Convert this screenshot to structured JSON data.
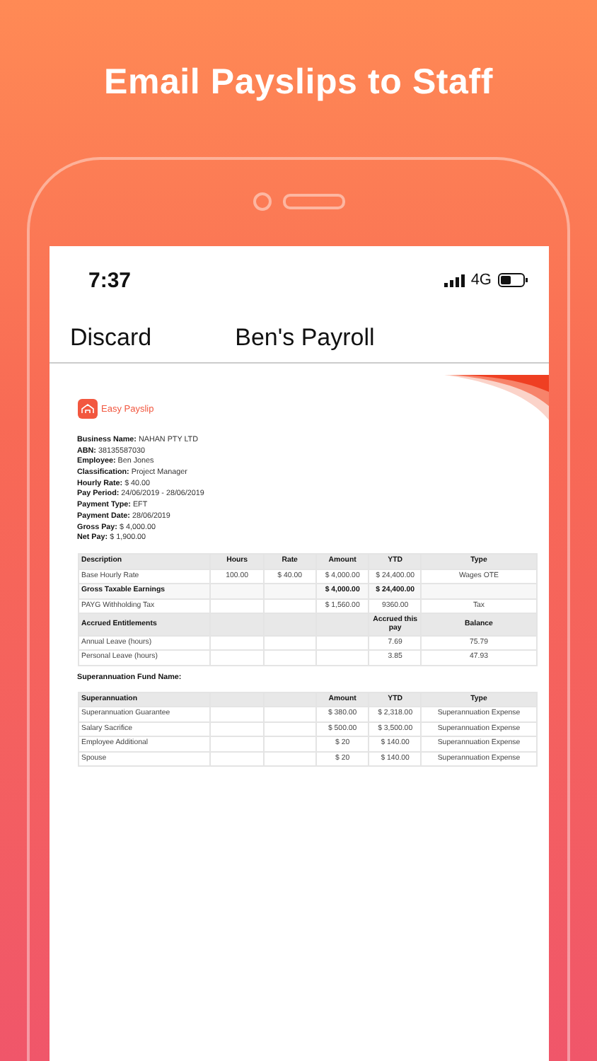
{
  "headline": "Email Payslips to Staff",
  "status_bar": {
    "time": "7:37",
    "network": "4G"
  },
  "nav": {
    "left": "Discard",
    "title": "Ben's Payroll"
  },
  "payslip": {
    "brand": "Easy Payslip",
    "fields": [
      {
        "label": "Business Name:",
        "value": "NAHAN PTY LTD"
      },
      {
        "label": "ABN:",
        "value": "38135587030"
      },
      {
        "label": "Employee:",
        "value": "Ben Jones"
      },
      {
        "label": "Classification:",
        "value": "Project Manager"
      },
      {
        "label": "Hourly Rate:",
        "value": "$ 40.00"
      },
      {
        "label": "Pay Period:",
        "value": "24/06/2019 - 28/06/2019"
      },
      {
        "label": "Payment Type:",
        "value": "EFT"
      },
      {
        "label": "Payment Date:",
        "value": "28/06/2019"
      },
      {
        "label": "Gross Pay:",
        "value": "$ 4,000.00"
      },
      {
        "label": "Net Pay:",
        "value": "$ 1,900.00"
      }
    ],
    "earnings_table": {
      "rows": [
        {
          "kind": "header",
          "cells": [
            "Description",
            "Hours",
            "Rate",
            "Amount",
            "YTD",
            "Type"
          ]
        },
        {
          "kind": "item",
          "cells": [
            "Base Hourly Rate",
            "100.00",
            "$ 40.00",
            "$ 4,000.00",
            "$ 24,400.00",
            "Wages OTE"
          ]
        },
        {
          "kind": "total",
          "cells": [
            "Gross Taxable Earnings",
            null,
            null,
            "$ 4,000.00",
            "$ 24,400.00",
            null
          ]
        },
        {
          "kind": "item",
          "cells": [
            "PAYG Withholding Tax",
            null,
            null,
            "$ 1,560.00",
            "9360.00",
            "Tax"
          ]
        },
        {
          "kind": "header",
          "cells": [
            "Accrued Entitlements",
            null,
            null,
            null,
            "Accrued this pay",
            "Balance"
          ]
        },
        {
          "kind": "item",
          "cells": [
            "Annual Leave (hours)",
            null,
            null,
            null,
            "7.69",
            "75.79"
          ]
        },
        {
          "kind": "item",
          "cells": [
            "Personal Leave (hours)",
            null,
            null,
            null,
            "3.85",
            "47.93"
          ]
        }
      ]
    },
    "fund_label": "Superannuation Fund Name:",
    "super_table": {
      "rows": [
        {
          "kind": "header",
          "cells": [
            "Superannuation",
            null,
            null,
            "Amount",
            "YTD",
            "Type"
          ]
        },
        {
          "kind": "item",
          "cells": [
            "Superannuation Guarantee",
            null,
            null,
            "$ 380.00",
            "$ 2,318.00",
            "Superannuation Expense"
          ]
        },
        {
          "kind": "item",
          "cells": [
            "Salary Sacrifice",
            null,
            null,
            "$ 500.00",
            "$ 3,500.00",
            "Superannuation Expense"
          ]
        },
        {
          "kind": "item",
          "cells": [
            "Employee Additional",
            null,
            null,
            "$ 20",
            "$ 140.00",
            "Superannuation Expense"
          ]
        },
        {
          "kind": "item",
          "cells": [
            "Spouse",
            null,
            null,
            "$ 20",
            "$ 140.00",
            "Superannuation Expense"
          ]
        }
      ]
    }
  }
}
